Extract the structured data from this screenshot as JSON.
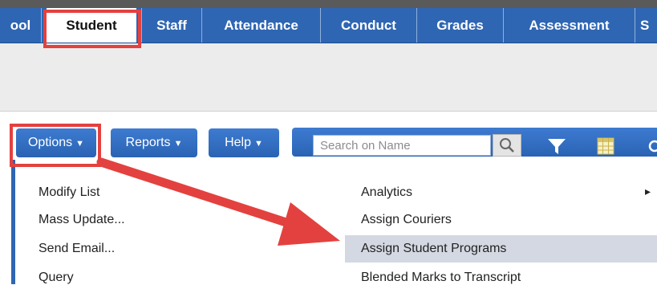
{
  "tabs": [
    {
      "label": "ool",
      "active": false
    },
    {
      "label": "Student",
      "active": true
    },
    {
      "label": "Staff",
      "active": false
    },
    {
      "label": "Attendance",
      "active": false
    },
    {
      "label": "Conduct",
      "active": false
    },
    {
      "label": "Grades",
      "active": false
    },
    {
      "label": "Assessment",
      "active": false
    },
    {
      "label": "S",
      "active": false
    }
  ],
  "toolbar": {
    "options_label": "Options",
    "reports_label": "Reports",
    "help_label": "Help",
    "search_placeholder": "Search on Name"
  },
  "icons": {
    "search": "magnifier-icon",
    "filter": "filter-icon",
    "grid": "grid-view-icon"
  },
  "options_menu": {
    "left_items": [
      "Modify List",
      "Mass Update...",
      "Send Email...",
      "Query"
    ],
    "right_items": [
      "Analytics",
      "Assign Couriers",
      "Assign Student Programs",
      "Blended Marks to Transcript"
    ],
    "highlighted_item": "Assign Student Programs",
    "submenu_arrow": "▸"
  },
  "colors": {
    "tab_bar": "#2f66b3",
    "button": "#3d7bd1",
    "highlight": "#d3d8e2",
    "annotation_red": "#e3413f"
  }
}
